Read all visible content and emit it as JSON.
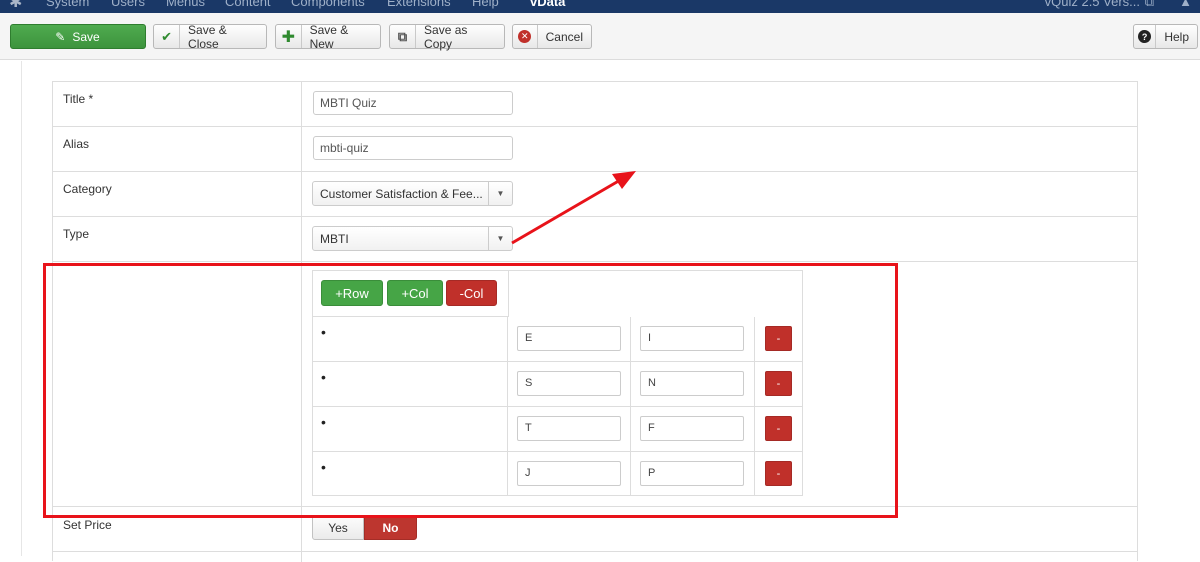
{
  "topnav": {
    "items": [
      "System",
      "Users",
      "Menus",
      "Content",
      "Components",
      "Extensions",
      "Help",
      "vData"
    ],
    "right_text": "vQuiz 2.5 Vers...",
    "colors": {
      "background": "#1a3867"
    }
  },
  "toolbar": {
    "save": "Save",
    "save_close": "Save & Close",
    "save_new": "Save & New",
    "save_copy": "Save as Copy",
    "cancel": "Cancel",
    "help": "Help"
  },
  "form": {
    "title_label": "Title *",
    "title_value": "MBTI Quiz",
    "alias_label": "Alias",
    "alias_value": "mbti-quiz",
    "category_label": "Category",
    "category_value": "Customer Satisfaction & Fee...",
    "type_label": "Type",
    "type_value": "MBTI",
    "price_label": "Set Price",
    "price_yes": "Yes",
    "price_no": "No",
    "price_selected": "No"
  },
  "mbti_grid": {
    "add_row": "+Row",
    "add_col": "+Col",
    "remove_col": "-Col",
    "bullet": "•",
    "delete_label": "-",
    "rows": [
      {
        "a": "E",
        "b": "I"
      },
      {
        "a": "S",
        "b": "N"
      },
      {
        "a": "T",
        "b": "F"
      },
      {
        "a": "J",
        "b": "P"
      }
    ]
  },
  "colors": {
    "accent_green": "#46a546",
    "accent_red": "#c0302a",
    "annotation_red": "#e8131a"
  }
}
